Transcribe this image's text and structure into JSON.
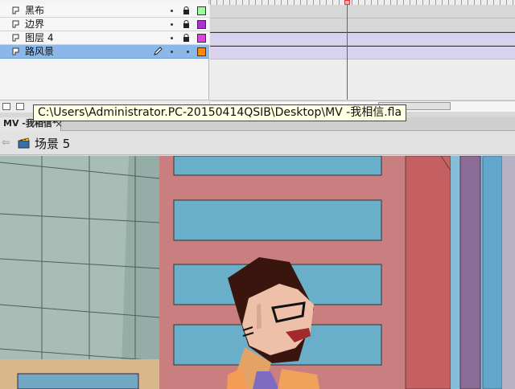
{
  "timeline": {
    "layers": [
      {
        "name": "黑布",
        "color": "#99ff99",
        "selected": false,
        "has_pencil": false
      },
      {
        "name": "边界",
        "color": "#aa33cc",
        "selected": false,
        "has_pencil": false
      },
      {
        "name": "图层 4",
        "color": "#dd44dd",
        "selected": false,
        "has_pencil": false
      },
      {
        "name": "路风景",
        "color": "#ff8800",
        "selected": true,
        "has_pencil": true
      }
    ]
  },
  "tooltip": {
    "text": "C:\\Users\\Administrator.PC-20150414QSIB\\Desktop\\MV -我相信.fla"
  },
  "document": {
    "tab_label": "MV -我相信*",
    "close_label": "×"
  },
  "scene": {
    "label": "场景 5",
    "back_icon": "back-arrow-icon",
    "icon": "scene-clapper-icon"
  },
  "colors": {
    "accent_selected": "#8bb8e8",
    "playhead": "#d33333",
    "stage_background": "#c97e7f"
  }
}
